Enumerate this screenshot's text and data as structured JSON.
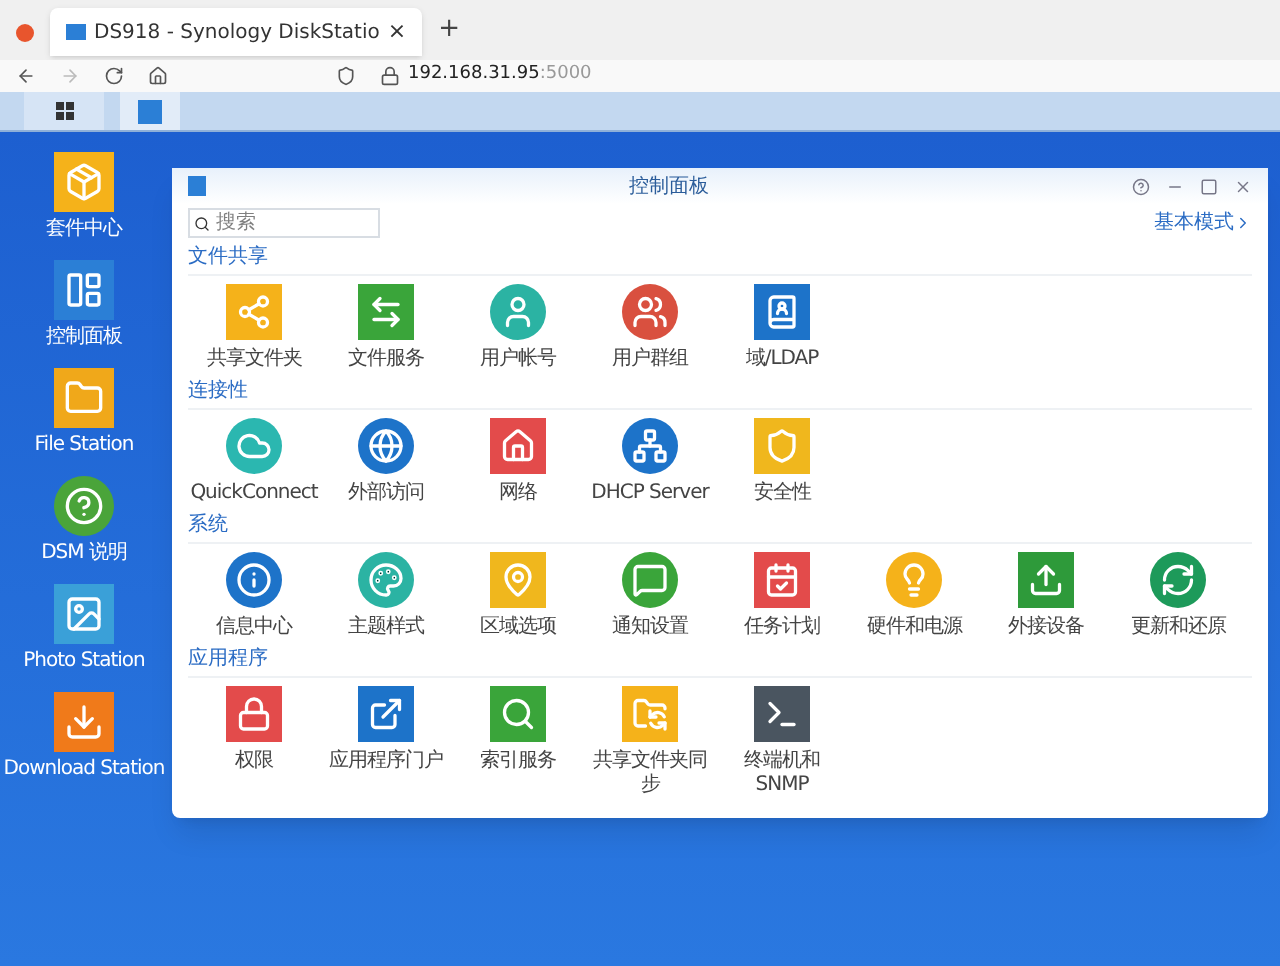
{
  "browser": {
    "tab_title": "DS918 - Synology DiskStatio",
    "tab_close": "×",
    "new_tab": "+",
    "address_host": "192.168.31.95",
    "address_port": ":5000"
  },
  "desktop_icons": [
    {
      "label": "套件中心",
      "kind": "package"
    },
    {
      "label": "控制面板",
      "kind": "panel"
    },
    {
      "label": "File Station",
      "kind": "folder"
    },
    {
      "label": "DSM 说明",
      "kind": "help"
    },
    {
      "label": "Photo Station",
      "kind": "photo"
    },
    {
      "label": "Download Station",
      "kind": "download"
    }
  ],
  "window": {
    "title": "控制面板",
    "search": {
      "placeholder": "搜索"
    },
    "mode_link": "基本模式",
    "sections": [
      {
        "title": "文件共享",
        "items": [
          {
            "label": "共享文件夹",
            "kind": "share"
          },
          {
            "label": "文件服务",
            "kind": "fileservice"
          },
          {
            "label": "用户帐号",
            "kind": "user"
          },
          {
            "label": "用户群组",
            "kind": "group"
          },
          {
            "label": "域/LDAP",
            "kind": "ldap"
          }
        ]
      },
      {
        "title": "连接性",
        "items": [
          {
            "label": "QuickConnect",
            "kind": "cloud"
          },
          {
            "label": "外部访问",
            "kind": "globe"
          },
          {
            "label": "网络",
            "kind": "home"
          },
          {
            "label": "DHCP Server",
            "kind": "dhcp"
          },
          {
            "label": "安全性",
            "kind": "shield"
          }
        ]
      },
      {
        "title": "系统",
        "items": [
          {
            "label": "信息中心",
            "kind": "info"
          },
          {
            "label": "主题样式",
            "kind": "palette"
          },
          {
            "label": "区域选项",
            "kind": "region"
          },
          {
            "label": "通知设置",
            "kind": "chat"
          },
          {
            "label": "任务计划",
            "kind": "calendar"
          },
          {
            "label": "硬件和电源",
            "kind": "bulb"
          },
          {
            "label": "外接设备",
            "kind": "upload"
          },
          {
            "label": "更新和还原",
            "kind": "update"
          }
        ]
      },
      {
        "title": "应用程序",
        "items": [
          {
            "label": "权限",
            "kind": "privilege"
          },
          {
            "label": "应用程序门户",
            "kind": "portal"
          },
          {
            "label": "索引服务",
            "kind": "index"
          },
          {
            "label": "共享文件夹同步",
            "kind": "sync"
          },
          {
            "label": "终端机和 SNMP",
            "kind": "terminal"
          }
        ]
      }
    ]
  }
}
